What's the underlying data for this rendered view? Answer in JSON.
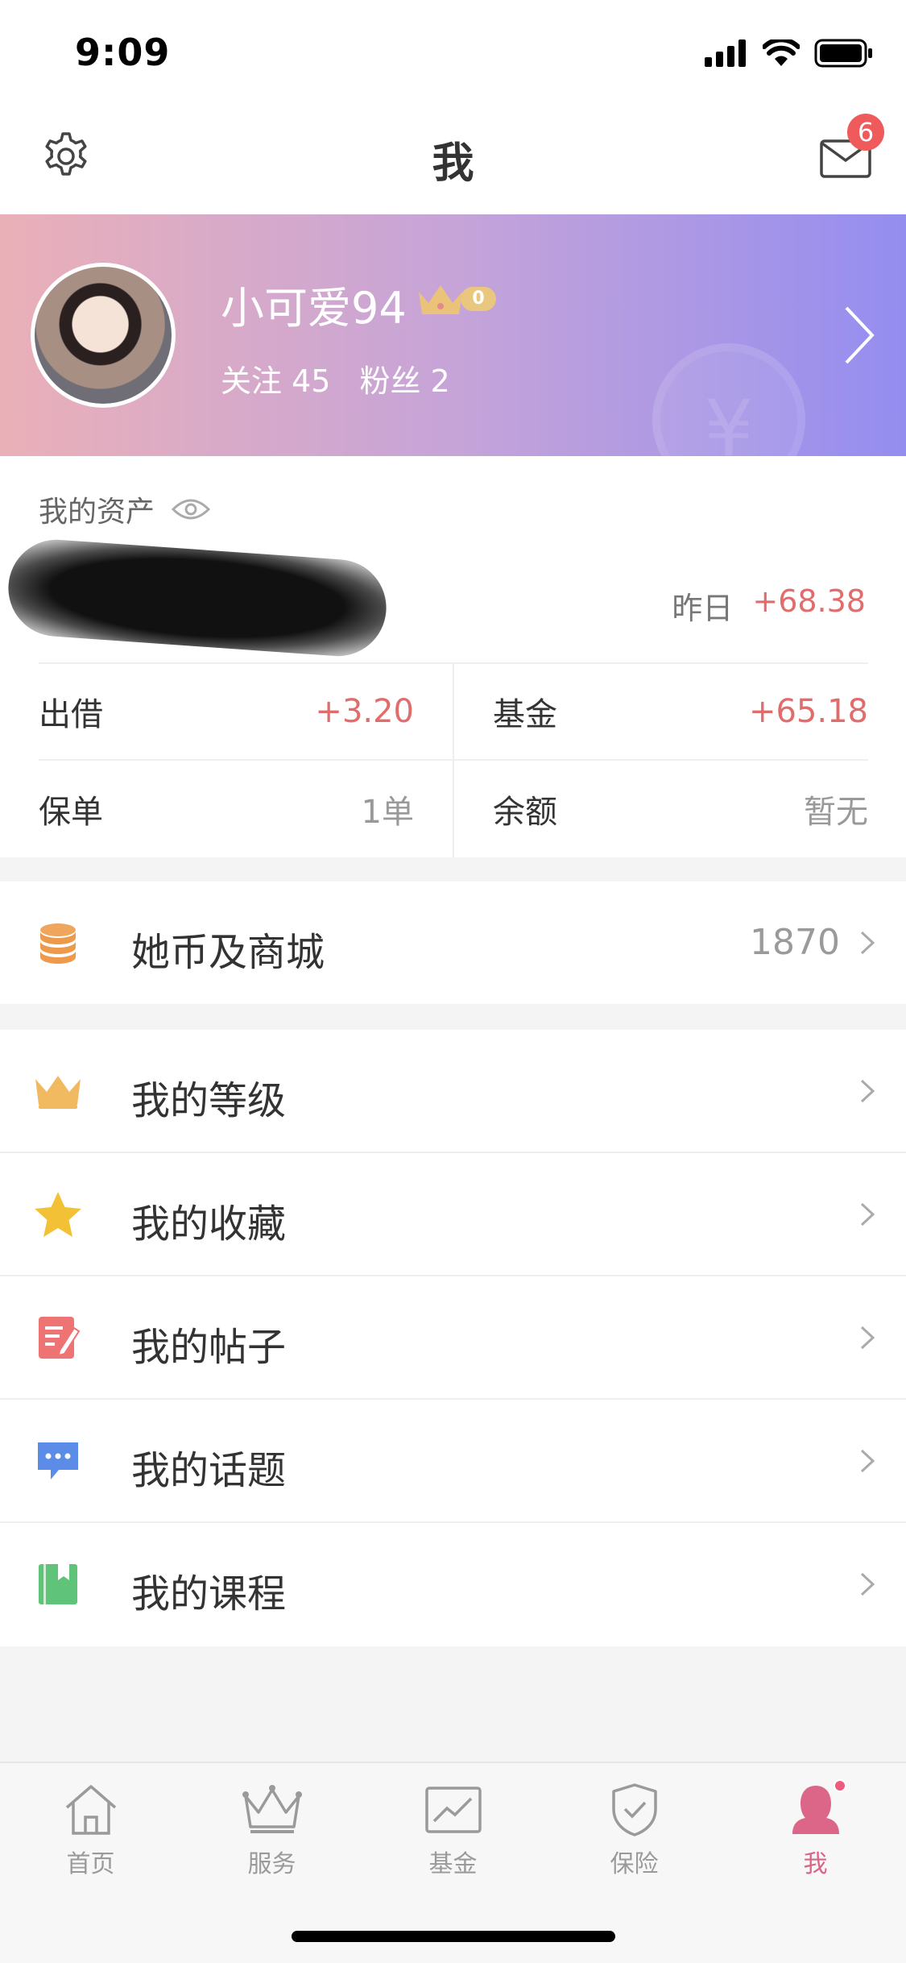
{
  "status_bar": {
    "time": "9:09"
  },
  "header": {
    "title": "我",
    "mail_badge": "6"
  },
  "profile": {
    "username": "小可爱94",
    "level": "0",
    "following": "关注 45",
    "followers": "粉丝 2",
    "watermark_symbol": "¥"
  },
  "assets": {
    "title": "我的资产",
    "yesterday_label": "昨日",
    "yesterday_value": "+68.38",
    "grid": [
      {
        "left_key": "出借",
        "left_value": "+3.20",
        "right_key": "基金",
        "right_value": "+65.18"
      },
      {
        "left_key": "保单",
        "left_value": "1单",
        "right_key": "余额",
        "right_value": "暂无"
      }
    ]
  },
  "coins": {
    "label": "她币及商城",
    "value": "1870"
  },
  "menu": [
    {
      "label": "我的等级",
      "icon": "crown-icon"
    },
    {
      "label": "我的收藏",
      "icon": "star-icon"
    },
    {
      "label": "我的帖子",
      "icon": "post-icon"
    },
    {
      "label": "我的话题",
      "icon": "chat-icon"
    },
    {
      "label": "我的课程",
      "icon": "book-icon"
    }
  ],
  "tabs": [
    {
      "label": "首页",
      "icon": "home-icon"
    },
    {
      "label": "服务",
      "icon": "crown-outline-icon"
    },
    {
      "label": "基金",
      "icon": "chart-icon"
    },
    {
      "label": "保险",
      "icon": "shield-icon"
    },
    {
      "label": "我",
      "icon": "user-icon",
      "active": true
    }
  ],
  "colors": {
    "accent": "#d96485",
    "positive": "#e06c6c",
    "banner_start": "#eab0b8",
    "banner_end": "#948df0"
  }
}
